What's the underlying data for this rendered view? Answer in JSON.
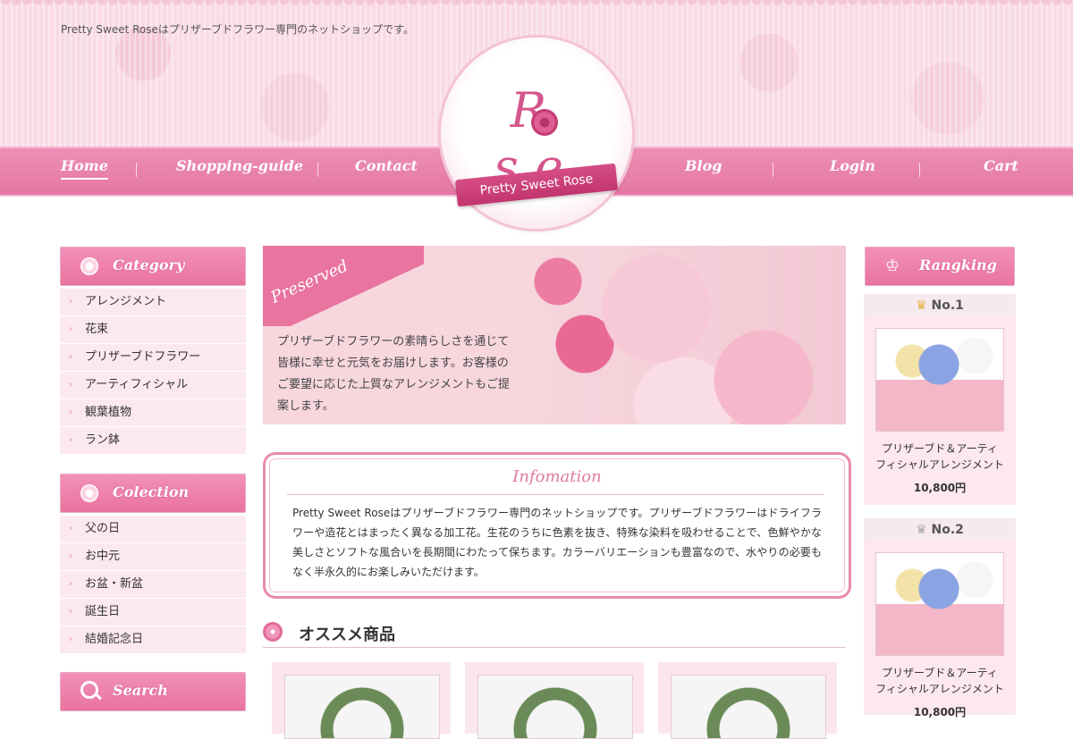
{
  "header": {
    "tagline": "Pretty Sweet Roseはプリザーブドフラワー専門のネットショップです。",
    "logo_text": "R se",
    "logo_ribbon": "Pretty Sweet Rose",
    "nav": [
      "Home",
      "Shopping-guide",
      "Contact",
      "Blog",
      "Login",
      "Cart"
    ]
  },
  "category": {
    "title": "Category",
    "items": [
      "アレンジメント",
      "花束",
      "プリザーブドフラワー",
      "アーティフィシャル",
      "観葉植物",
      "ラン鉢"
    ]
  },
  "colection": {
    "title": "Colection",
    "items": [
      "父の日",
      "お中元",
      "お盆・新盆",
      "誕生日",
      "結婚記念日"
    ]
  },
  "search": {
    "title": "Search"
  },
  "hero": {
    "badge": "Preserved",
    "text": "プリザーブドフラワーの素晴らしさを通じて皆様に幸せと元気をお届けします。お客様のご要望に応じた上質なアレンジメントもご提案します。"
  },
  "info": {
    "title": "Infomation",
    "body": "Pretty Sweet Roseはプリザーブドフラワー専門のネットショップです。プリザーブドフラワーはドライフラワーや造花とはまったく異なる加工花。生花のうちに色素を抜き、特殊な染料を吸わせることで、色鮮やかな美しさとソフトな風合いを長期間にわたって保ちます。カラーバリエーションも豊富なので、水やりの必要もなく半永久的にお楽しみいただけます。"
  },
  "recommend": {
    "title": "オススメ商品"
  },
  "ranking": {
    "title": "Rangking",
    "items": [
      {
        "rank": "No.1",
        "name_line1": "プリザーブド＆アーティ",
        "name_line2": "フィシャルアレンジメント",
        "price": "10,800円"
      },
      {
        "rank": "No.2",
        "name_line1": "プリザーブド＆アーティ",
        "name_line2": "フィシャルアレンジメント",
        "price": "10,800円"
      }
    ]
  }
}
